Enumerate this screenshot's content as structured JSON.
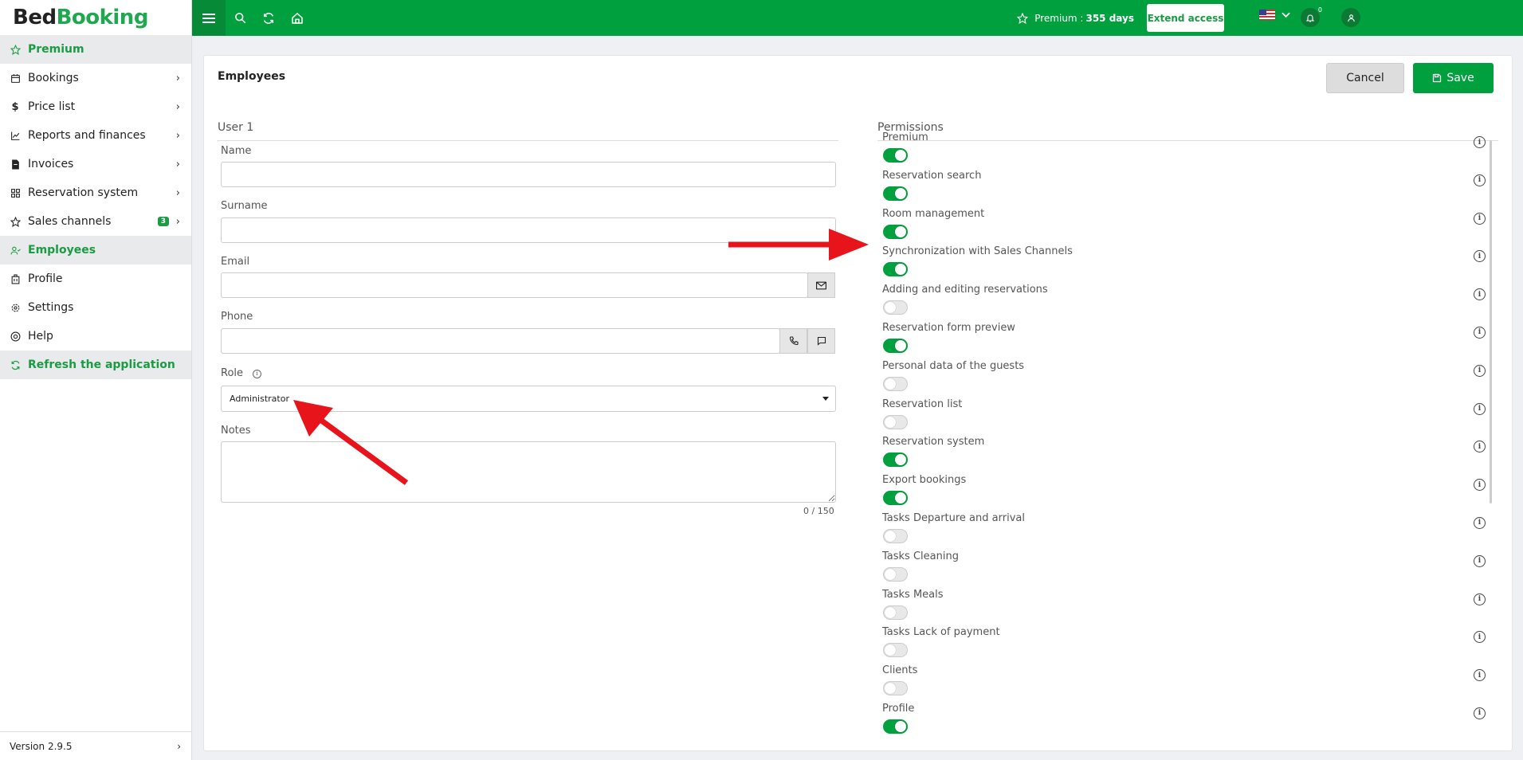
{
  "brand": {
    "part1": "Bed",
    "part2": "Booking"
  },
  "sidebar": {
    "items": [
      {
        "label": "Premium"
      },
      {
        "label": "Bookings"
      },
      {
        "label": "Price list"
      },
      {
        "label": "Reports and finances"
      },
      {
        "label": "Invoices"
      },
      {
        "label": "Reservation system"
      },
      {
        "label": "Sales channels",
        "badge": "3"
      },
      {
        "label": "Employees"
      },
      {
        "label": "Profile"
      },
      {
        "label": "Settings"
      },
      {
        "label": "Help"
      },
      {
        "label": "Refresh the application"
      }
    ],
    "version": "Version 2.9.5"
  },
  "topbar": {
    "premium_label": "Premium :",
    "premium_days": "355 days",
    "extend_label": "Extend access",
    "notifications_count": "0"
  },
  "page": {
    "title": "Employees",
    "cancel_label": "Cancel",
    "save_label": "Save"
  },
  "user": {
    "section_title": "User 1",
    "name_label": "Name",
    "name_value": "",
    "surname_label": "Surname",
    "surname_value": "",
    "email_label": "Email",
    "email_value": "",
    "phone_label": "Phone",
    "phone_value": "",
    "role_label": "Role",
    "role_value": "Administrator",
    "notes_label": "Notes",
    "notes_counter": "0 / 150"
  },
  "permissions": {
    "section_title": "Permissions",
    "items": [
      {
        "label": "Premium",
        "enabled": true
      },
      {
        "label": "Reservation search",
        "enabled": true
      },
      {
        "label": "Room management",
        "enabled": true
      },
      {
        "label": "Synchronization with Sales Channels",
        "enabled": true
      },
      {
        "label": "Adding and editing reservations",
        "enabled": false
      },
      {
        "label": "Reservation form preview",
        "enabled": true
      },
      {
        "label": "Personal data of the guests",
        "enabled": false
      },
      {
        "label": "Reservation list",
        "enabled": false
      },
      {
        "label": "Reservation system",
        "enabled": true
      },
      {
        "label": "Export bookings",
        "enabled": true
      },
      {
        "label": "Tasks Departure and arrival",
        "enabled": false
      },
      {
        "label": "Tasks Cleaning",
        "enabled": false
      },
      {
        "label": "Tasks Meals",
        "enabled": false
      },
      {
        "label": "Tasks Lack of payment",
        "enabled": false
      },
      {
        "label": "Clients",
        "enabled": false
      },
      {
        "label": "Profile",
        "enabled": true
      }
    ]
  },
  "colors": {
    "accent": "#00a03e",
    "arrow": "#e8141b"
  }
}
